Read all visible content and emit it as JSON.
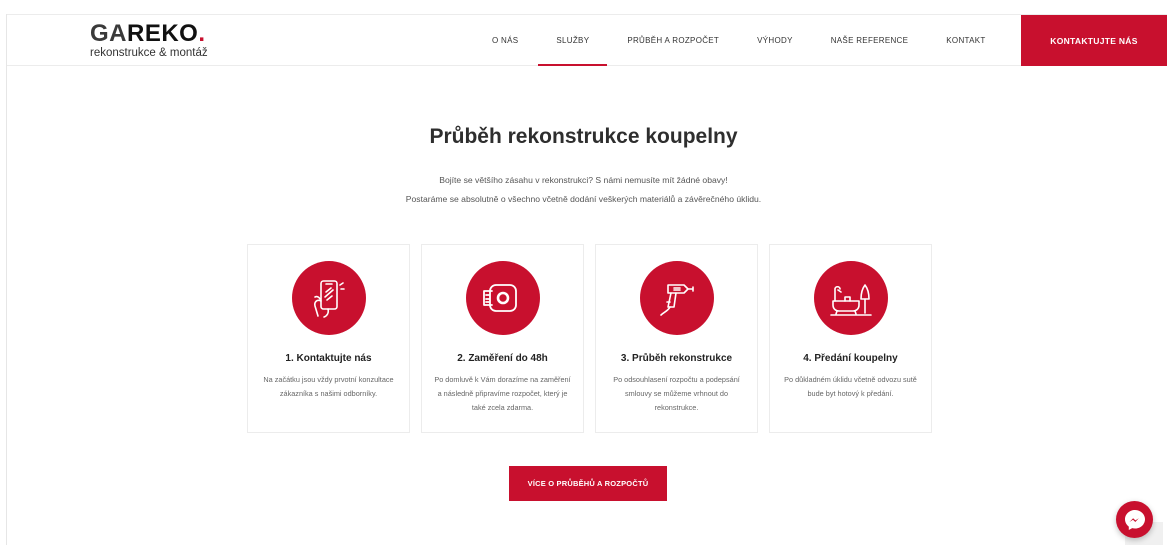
{
  "logo": {
    "part1": "GA",
    "part2": "REKO",
    "dot": ".",
    "tagline": "rekonstrukce & montáž"
  },
  "nav": {
    "items": [
      {
        "label": "O NÁS"
      },
      {
        "label": "SLUŽBY"
      },
      {
        "label": "PRŮBĚH A ROZPOČET"
      },
      {
        "label": "VÝHODY"
      },
      {
        "label": "NAŠE REFERENCE"
      },
      {
        "label": "KONTAKT"
      }
    ],
    "active": "SLUŽBY",
    "cta_label": "KONTAKTUJTE NÁS"
  },
  "section": {
    "title": "Průběh rekonstrukce koupelny",
    "intro_line1": "Bojíte se většího zásahu v rekonstrukci? S námi nemusíte mít žádné obavy!",
    "intro_line2": "Postaráme se absolutně o všechno včetně dodání veškerých materiálů a závěrečného úklidu."
  },
  "steps": [
    {
      "icon": "phone-icon",
      "title": "1. Kontaktujte nás",
      "text": "Na začátku jsou vždy prvotní konzultace zákazníka s našimi odborníky."
    },
    {
      "icon": "tape-measure-icon",
      "title": "2. Zaměření do 48h",
      "text": "Po domluvě k Vám dorazíme na zaměření a následně připravíme rozpočet, který je také zcela zdarma."
    },
    {
      "icon": "drill-icon",
      "title": "3. Průběh rekonstrukce",
      "text": "Po odsouhlasení rozpočtu a podepsání smlouvy se můžeme vrhnout do rekonstrukce."
    },
    {
      "icon": "bathtub-icon",
      "title": "4. Předání koupelny",
      "text": "Po důkladném úklidu včetně odvozu sutě bude byt hotový k předání."
    }
  ],
  "more_button": "VÍCE O PRŮBĚHŮ A ROZPOČTŮ",
  "colors": {
    "accent": "#c8102e",
    "text": "#2e2e2e",
    "muted": "#666666"
  }
}
